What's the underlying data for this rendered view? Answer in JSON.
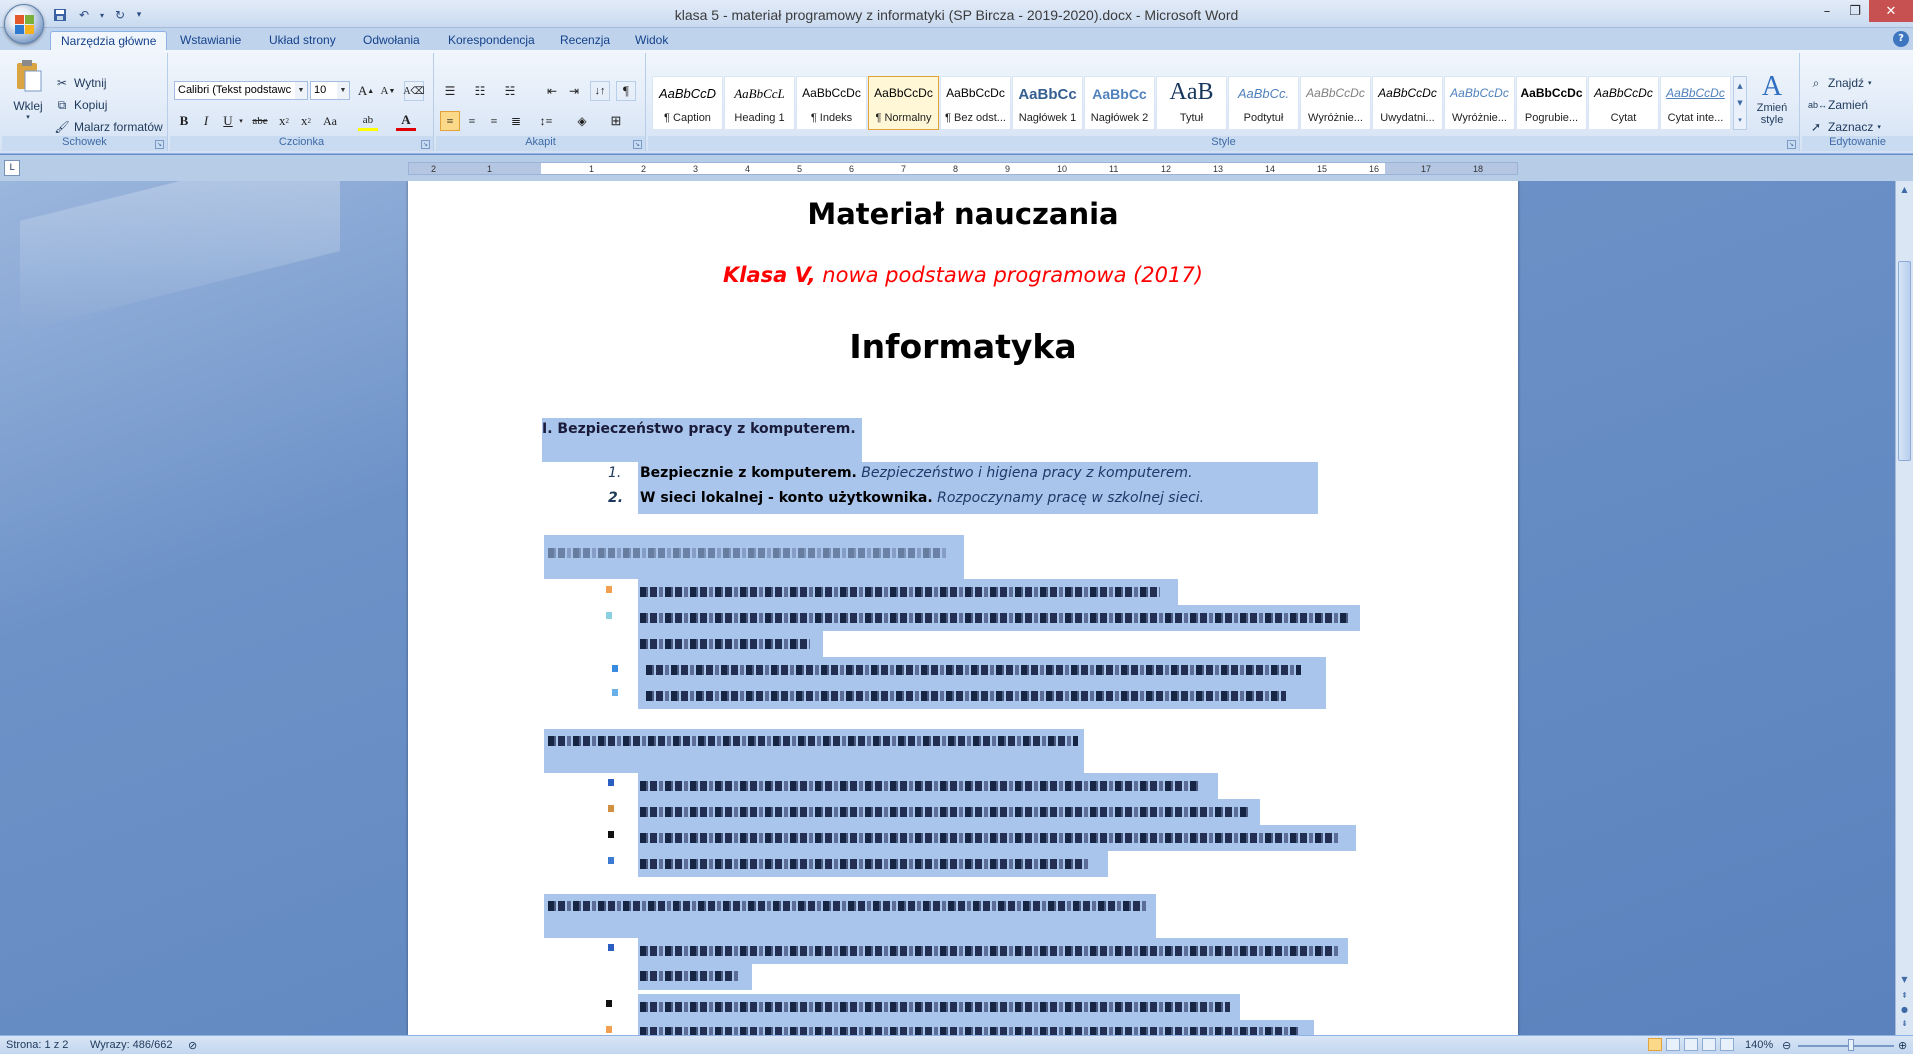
{
  "window": {
    "title": "klasa 5 - materiał programowy z informatyki (SP Bircza  - 2019-2020).docx - Microsoft Word"
  },
  "qat": {
    "save": "save-icon",
    "undo": "undo-icon",
    "redo": "redo-icon",
    "customize": "▾"
  },
  "tabs": [
    "Narzędzia główne",
    "Wstawianie",
    "Układ strony",
    "Odwołania",
    "Korespondencja",
    "Recenzja",
    "Widok"
  ],
  "ribbon": {
    "clipboard": {
      "paste": "Wklej",
      "cut": "Wytnij",
      "copy": "Kopiuj",
      "format_painter": "Malarz formatów",
      "label": "Schowek"
    },
    "font": {
      "family": "Calibri (Tekst podstawc",
      "size": "10",
      "label": "Czcionka"
    },
    "paragraph": {
      "label": "Akapit"
    },
    "styles": {
      "label": "Style",
      "items": [
        {
          "sample": "AaBbCcD",
          "name": "¶ Caption"
        },
        {
          "sample": "AaBbCcL",
          "name": "Heading 1"
        },
        {
          "sample": "AaBbCcDc",
          "name": "¶ Indeks"
        },
        {
          "sample": "AaBbCcDc",
          "name": "¶ Normalny"
        },
        {
          "sample": "AaBbCcDc",
          "name": "¶ Bez odst..."
        },
        {
          "sample": "AaBbCc",
          "name": "Nagłówek 1"
        },
        {
          "sample": "AaBbCc",
          "name": "Nagłówek 2"
        },
        {
          "sample": "AaB",
          "name": "Tytuł"
        },
        {
          "sample": "AaBbCc.",
          "name": "Podtytuł"
        },
        {
          "sample": "AaBbCcDc",
          "name": "Wyróżnie..."
        },
        {
          "sample": "AaBbCcDc",
          "name": "Uwydatni..."
        },
        {
          "sample": "AaBbCcDc",
          "name": "Wyróżnie..."
        },
        {
          "sample": "AaBbCcDc",
          "name": "Pogrubie..."
        },
        {
          "sample": "AaBbCcDc",
          "name": "Cytat"
        },
        {
          "sample": "AaBbCcDc",
          "name": "Cytat inte..."
        }
      ],
      "change_styles": "Zmień style"
    },
    "editing": {
      "find": "Znajdź",
      "replace": "Zamień",
      "select": "Zaznacz",
      "label": "Edytowanie"
    }
  },
  "ruler": {
    "ticks": [
      "2",
      "1",
      "1",
      "2",
      "3",
      "4",
      "5",
      "6",
      "7",
      "8",
      "9",
      "10",
      "11",
      "12",
      "13",
      "14",
      "15",
      "16",
      "17",
      "18"
    ]
  },
  "document": {
    "title": "Materiał nauczania",
    "subtitle_bold": "Klasa V,",
    "subtitle_rest": " nowa podstawa programowa (2017)",
    "subject": "Informatyka",
    "section1": "I. Bezpieczeństwo pracy z komputerem.",
    "items": [
      {
        "num": "1.",
        "bold": "Bezpiecznie z komputerem.",
        "italic": " Bezpieczeństwo i higiena pracy z komputerem."
      },
      {
        "num": "2.",
        "bold": "W sieci lokalnej - konto użytkownika.",
        "italic": " Rozpoczynamy pracę w szkolnej sieci."
      }
    ]
  },
  "status": {
    "page": "Strona: 1 z 2",
    "words": "Wyrazy: 486/662",
    "zoom": "140%"
  }
}
